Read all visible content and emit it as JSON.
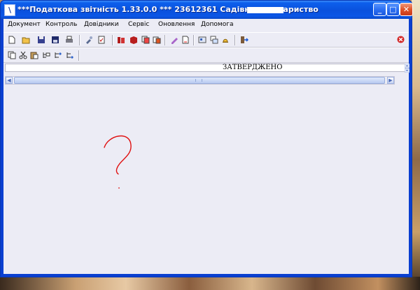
{
  "window": {
    "title": "***Податкова звітність 1.33.0.0 *** 23612361 Садівниче товариство",
    "icon_glyph": "\\",
    "controls": {
      "minimize": "_",
      "maximize": "□",
      "close": "✕"
    }
  },
  "menu": [
    "Документ",
    "Контроль",
    "Довідники",
    "Сервіс",
    "Оновлення",
    "Допомога"
  ],
  "toolbar1": {
    "icons": [
      "new-document-icon",
      "open-folder-icon",
      "save-icon",
      "save-as-icon",
      "print-icon",
      "tools-icon",
      "checklist-icon",
      "books-icon",
      "book-icon",
      "copy-documents-icon",
      "paste-documents-icon",
      "edit-pencil-icon",
      "document-page-icon",
      "settings-icon",
      "windows-icon",
      "bell-icon",
      "exit-icon"
    ],
    "close_icon": "close-icon"
  },
  "toolbar2": {
    "icons": [
      "copy-icon",
      "scissors-icon",
      "paste-icon",
      "tree-add-icon",
      "tree-link-icon",
      "tree-branch-icon"
    ]
  },
  "document": {
    "status_label": "ЗАТВЕРДЖЕНО"
  },
  "colors": {
    "titlebar": "#0a51dd",
    "client": "#ececf5",
    "annotation": "#e01010"
  }
}
